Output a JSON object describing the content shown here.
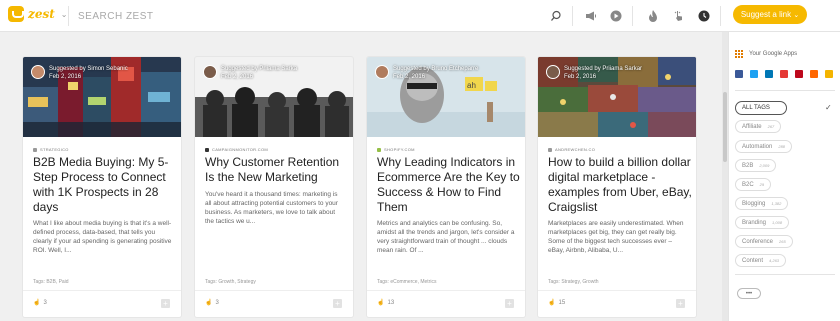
{
  "topbar": {
    "logo_text": "zest",
    "search_placeholder": "SEARCH ZEST",
    "icons": [
      "search-icon",
      "megaphone-icon",
      "play-icon",
      "flame-icon",
      "pointer-hand-icon",
      "clock-icon"
    ],
    "suggest_button": "Suggest a link",
    "accent_color": "#f6b900"
  },
  "sidebar": {
    "google_apps_label": "Your Google Apps",
    "apps": [
      "#3b5998",
      "#1da1f2",
      "#0077b5",
      "#e53935",
      "#bd081c",
      "#ff6600",
      "#f4b400",
      "#4285f4"
    ],
    "all_tags_label": "ALL TAGS",
    "tags": [
      {
        "label": "Affiliate",
        "count": "267"
      },
      {
        "label": "Automation",
        "count": "288"
      },
      {
        "label": "B2B",
        "count": "2,009"
      },
      {
        "label": "B2C",
        "count": "29"
      },
      {
        "label": "Blogging",
        "count": "1,382"
      },
      {
        "label": "Branding",
        "count": "1,008"
      },
      {
        "label": "Conference",
        "count": "265"
      },
      {
        "label": "Content",
        "count": "4,263"
      }
    ],
    "more_label": "•••"
  },
  "cards": [
    {
      "suggested_by": "Suggested by Simon Sebanic",
      "date": "Feb 2, 2016",
      "source": "STRATEGICO",
      "title": "B2B Media Buying: My 5-Step Process to Connect with 1K Prospects in 28 days",
      "excerpt": "What I like about media buying is that it's a well-defined process, data-based, that tells you clearly if your ad spending is generating positive ROI. Well, I...",
      "tags": "Tags: B2B, Paid",
      "fires": "3"
    },
    {
      "suggested_by": "Suggested by Priiama Sarka",
      "date": "Feb 2, 2016",
      "source": "CAMPAIGNMONITOR.COM",
      "title": "Why Customer Retention Is the New Marketing",
      "excerpt": "You've heard it a thousand times: marketing is all about attracting potential customers to your business. As marketers, we love to talk about the tactics we u...",
      "tags": "Tags: Growth, Strategy",
      "fires": "3"
    },
    {
      "suggested_by": "Suggested by Bruno Etcheparre",
      "date": "Feb 2, 2016",
      "source": "SHOPIFY.COM",
      "title": "Why Leading Indicators in Ecommerce Are the Key to Success & How to Find Them",
      "excerpt": "Metrics and analytics can be confusing. So, amidst all the trends and jargon, let's consider a very straightforward train of thought ... clouds mean rain. Of ...",
      "tags": "Tags: eCommerce, Metrics",
      "fires": "13"
    },
    {
      "suggested_by": "Suggested by Priiama Sarkar",
      "date": "Feb 2, 2016",
      "source": "ANDREWCHEN.CO",
      "title": "How to build a billion dollar digital marketplace - examples from Uber, eBay, Craigslist",
      "excerpt": "Marketplaces are easily underestimated. When marketplaces get big, they can get really big. Some of the biggest tech successes ever – eBay, Airbnb, Alibaba, U...",
      "tags": "Tags: Strategy, Growth",
      "fires": "15"
    }
  ]
}
